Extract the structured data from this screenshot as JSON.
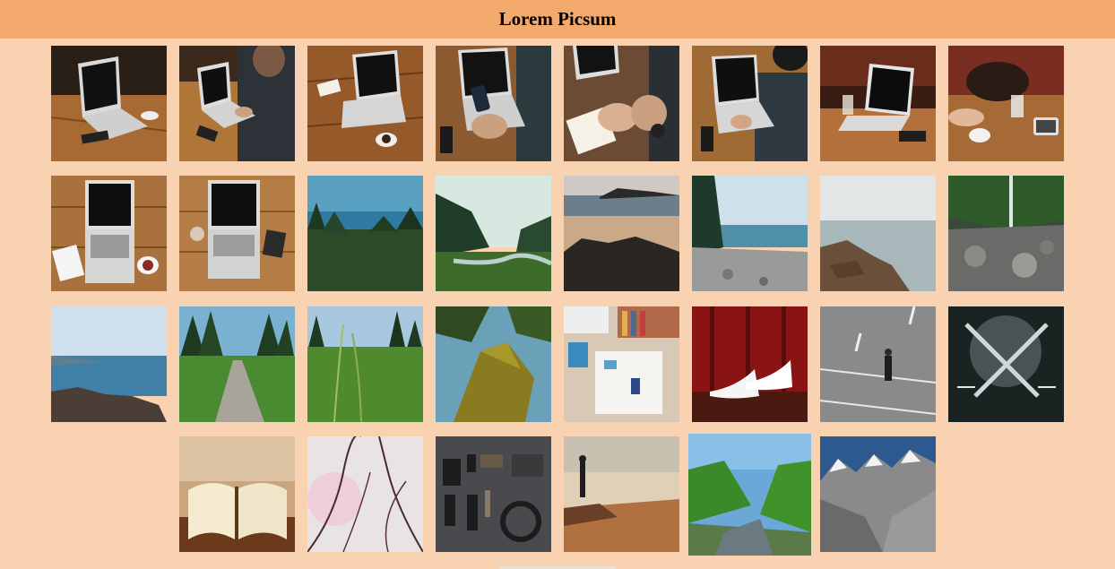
{
  "header": {
    "title": "Lorem Picsum"
  },
  "colors": {
    "header_bg": "#f4a96c",
    "page_bg": "#f9d2b2"
  },
  "gallery": {
    "photos": [
      {
        "name": "photo-laptop-desk-1",
        "icon": "laptop-desk-photo"
      },
      {
        "name": "photo-laptop-typing-1",
        "icon": "laptop-desk-photo"
      },
      {
        "name": "photo-laptop-desk-2",
        "icon": "laptop-desk-photo"
      },
      {
        "name": "photo-laptop-phone",
        "icon": "laptop-desk-photo"
      },
      {
        "name": "photo-notebook-watch",
        "icon": "laptop-desk-photo"
      },
      {
        "name": "photo-laptop-typing-2",
        "icon": "laptop-desk-photo"
      },
      {
        "name": "photo-laptop-cafe",
        "icon": "laptop-desk-photo"
      },
      {
        "name": "photo-bag-table",
        "icon": "laptop-desk-photo"
      },
      {
        "name": "photo-laptop-topdown-1",
        "icon": "laptop-topdown-photo"
      },
      {
        "name": "photo-laptop-topdown-2",
        "icon": "laptop-topdown-photo"
      },
      {
        "name": "photo-forest-lake",
        "icon": "landscape-photo"
      },
      {
        "name": "photo-valley-stream",
        "icon": "landscape-photo"
      },
      {
        "name": "photo-beach-rocks",
        "icon": "landscape-photo"
      },
      {
        "name": "photo-pebble-beach",
        "icon": "landscape-photo"
      },
      {
        "name": "photo-rocky-shore",
        "icon": "landscape-photo"
      },
      {
        "name": "photo-waterfall-ravine",
        "icon": "landscape-photo"
      },
      {
        "name": "photo-coast-rocks",
        "icon": "landscape-photo"
      },
      {
        "name": "photo-forest-path",
        "icon": "landscape-photo"
      },
      {
        "name": "photo-tall-grass",
        "icon": "landscape-photo"
      },
      {
        "name": "photo-mossy-tree",
        "icon": "landscape-photo"
      },
      {
        "name": "photo-desk-flatlay",
        "icon": "object-photo"
      },
      {
        "name": "photo-white-heels",
        "icon": "object-photo"
      },
      {
        "name": "photo-man-road",
        "icon": "object-photo"
      },
      {
        "name": "photo-forks-dark",
        "icon": "object-photo"
      },
      {
        "name": "photo-open-book",
        "icon": "object-photo"
      },
      {
        "name": "photo-blossom-branches",
        "icon": "landscape-photo"
      },
      {
        "name": "photo-gadgets-flatlay",
        "icon": "object-photo"
      },
      {
        "name": "photo-person-sunset",
        "icon": "landscape-photo"
      },
      {
        "name": "photo-green-canyon",
        "icon": "landscape-photo"
      },
      {
        "name": "photo-snow-mountains",
        "icon": "landscape-photo"
      }
    ]
  }
}
